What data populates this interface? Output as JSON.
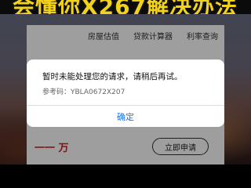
{
  "banner": {
    "headline": "会懂你X267解决办法"
  },
  "app": {
    "tabs": [
      "房屋估值",
      "贷款计算器",
      "利率查询"
    ],
    "amount": "一一 万",
    "apply_button": "立即申请"
  },
  "dialog": {
    "message": "暂时未能处理您的请求，请稍后再试。",
    "reference": "参考码：YBLA0672X207",
    "confirm_button": "确定"
  }
}
